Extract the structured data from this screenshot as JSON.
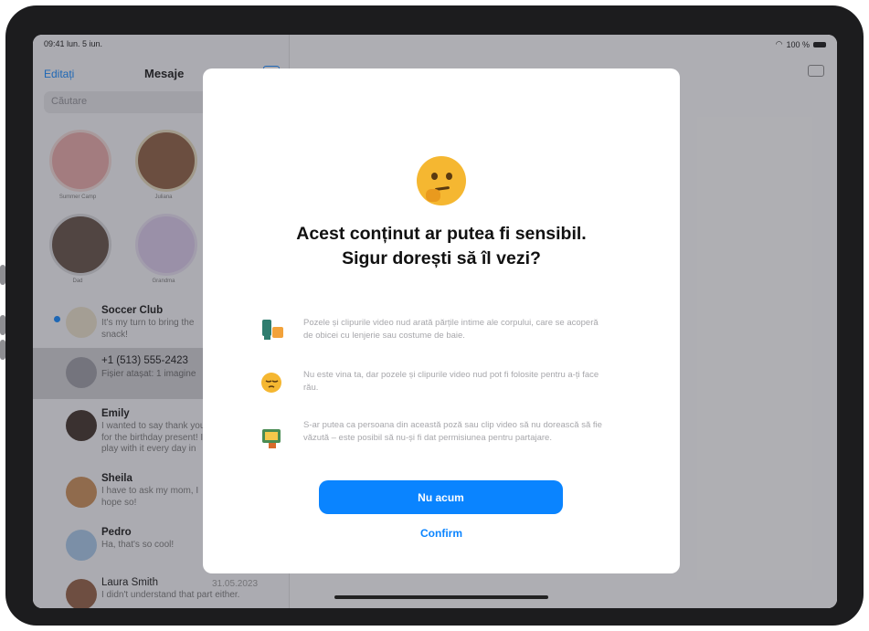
{
  "status_bar": {
    "time_date": "09:41 lun. 5 iun.",
    "battery": "100 %"
  },
  "sidebar": {
    "edit_label": "Editați",
    "title": "Mesaje",
    "search_placeholder": "Căutare",
    "pinned": [
      {
        "name": "Summer Camp",
        "color": "#e8a7a5"
      },
      {
        "name": "Juliana",
        "color": "#f1cfa0"
      },
      {
        "name": "Dad",
        "color": "#c9c9cd"
      },
      {
        "name": "Grandma",
        "color": "#d9c9ea"
      }
    ],
    "conversations": [
      {
        "name": "Soccer Club",
        "preview": "It's my turn to bring the snack!",
        "date": "",
        "unread": true
      },
      {
        "name": "+1 (513) 555-2423",
        "preview": "Fișier atașat: 1 imagine",
        "date": "",
        "selected": true
      },
      {
        "name": "Emily",
        "preview": "I wanted to say thank you for the birthday present! I play with it every day in the yard!",
        "date": ""
      },
      {
        "name": "Sheila",
        "preview": "I have to ask my mom, I hope so!",
        "date": ""
      },
      {
        "name": "Pedro",
        "preview": "Ha, that's so cool!",
        "date": ""
      },
      {
        "name": "Laura Smith",
        "preview": "I didn't understand that part either.",
        "date": "31.05.2023"
      }
    ]
  },
  "modal": {
    "emoji": "thinking-face",
    "title_line1": "Acest conținut ar putea fi sensibil.",
    "title_line2": "Sigur dorești să îl vezi?",
    "bullets": [
      {
        "icon": "clothing-icon",
        "text": "Pozele și clipurile video nud arată părțile intime ale corpului, care se acoperă de obicei cu lenjerie sau costume de baie."
      },
      {
        "icon": "pensive-face-icon",
        "text": "Nu este vina ta, dar pozele și clipurile video nud pot fi folosite pentru a-ți face rău."
      },
      {
        "icon": "camera-person-icon",
        "text": "S-ar putea ca persoana din această poză sau clip video să nu dorească să fie văzută – este posibil să nu-și fi dat permisiunea pentru partajare."
      }
    ],
    "primary_button": "Nu acum",
    "secondary_button": "Confirm"
  },
  "colors": {
    "accent": "#0a84ff",
    "emoji": "#f5b731"
  }
}
